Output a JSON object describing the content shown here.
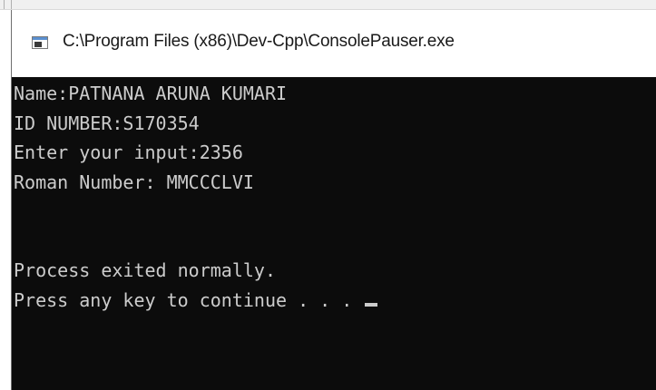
{
  "window": {
    "title": "C:\\Program Files (x86)\\Dev-Cpp\\ConsolePauser.exe",
    "icon": "console-app-icon"
  },
  "console": {
    "lines": [
      "Name:PATNANA ARUNA KUMARI",
      "ID NUMBER:S170354",
      "Enter your input:2356",
      "Roman Number: MMCCCLVI",
      "",
      "",
      "Process exited normally.",
      "Press any key to continue . . . "
    ],
    "colors": {
      "background": "#0c0c0c",
      "text": "#cccccc"
    }
  }
}
